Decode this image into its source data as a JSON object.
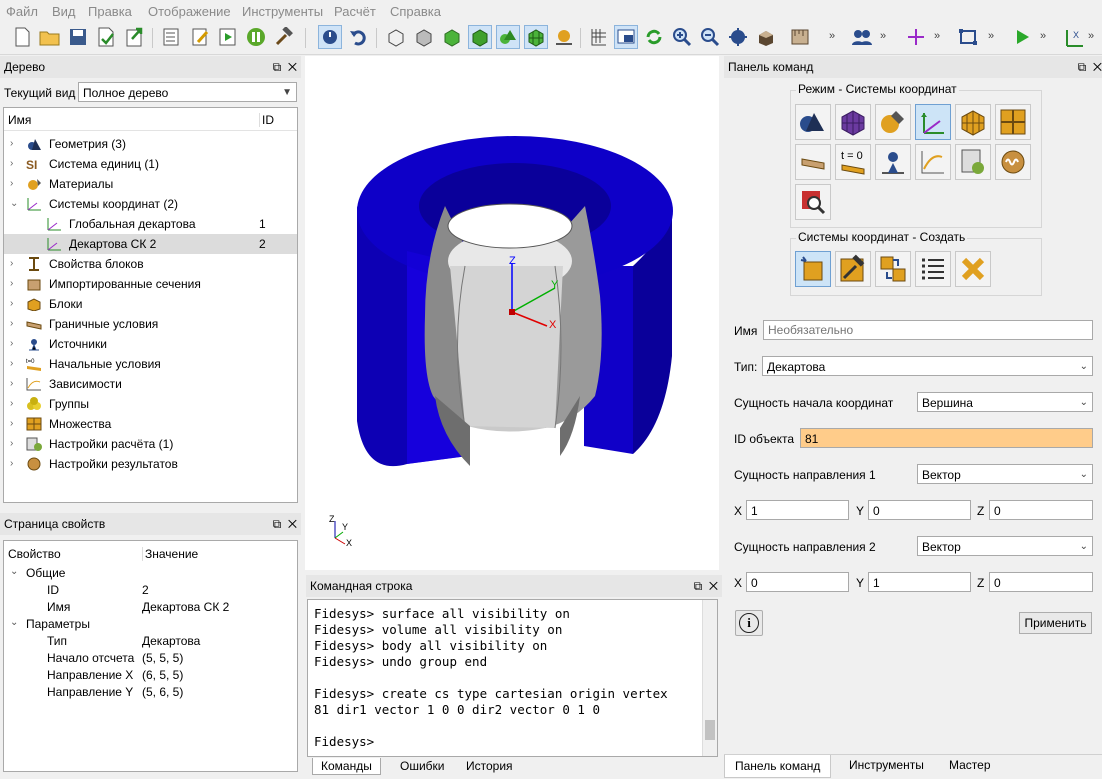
{
  "menu": [
    "Файл",
    "Вид",
    "Правка",
    "Отображение",
    "Инструменты",
    "Расчёт",
    "Справка"
  ],
  "tree_panel": {
    "title": "Дерево",
    "view_label": "Текущий вид",
    "view_value": "Полное дерево",
    "col_name": "Имя",
    "col_id": "ID",
    "items": [
      {
        "label": "Геометрия (3)",
        "id": "",
        "icon": "geometry-icon",
        "expanded": false
      },
      {
        "label": "Система единиц (1)",
        "id": "",
        "icon": "units-icon",
        "expanded": false
      },
      {
        "label": "Материалы",
        "id": "",
        "icon": "materials-icon",
        "expanded": null
      },
      {
        "label": "Системы координат (2)",
        "id": "",
        "icon": "coord-systems-icon",
        "expanded": true
      },
      {
        "label": "Глобальная декартова",
        "id": "1",
        "icon": "axes-icon",
        "child": true
      },
      {
        "label": "Декартова СК 2",
        "id": "2",
        "icon": "axes-icon",
        "child": true,
        "selected": true
      },
      {
        "label": "Свойства блоков",
        "id": "",
        "icon": "beam-icon",
        "expanded": false
      },
      {
        "label": "Импортированные сечения",
        "id": "",
        "icon": "sections-icon",
        "expanded": null
      },
      {
        "label": "Блоки",
        "id": "",
        "icon": "blocks-icon",
        "expanded": null
      },
      {
        "label": "Граничные условия",
        "id": "",
        "icon": "bc-icon",
        "expanded": false
      },
      {
        "label": "Источники",
        "id": "",
        "icon": "sources-icon",
        "expanded": false
      },
      {
        "label": "Начальные условия",
        "id": "",
        "icon": "initial-icon",
        "expanded": false
      },
      {
        "label": "Зависимости",
        "id": "",
        "icon": "dependencies-icon",
        "expanded": false
      },
      {
        "label": "Группы",
        "id": "",
        "icon": "groups-icon",
        "expanded": null
      },
      {
        "label": "Множества",
        "id": "",
        "icon": "sets-icon",
        "expanded": false
      },
      {
        "label": "Настройки расчёта (1)",
        "id": "",
        "icon": "calc-settings-icon",
        "expanded": false
      },
      {
        "label": "Настройки результатов",
        "id": "",
        "icon": "results-icon",
        "expanded": false
      }
    ]
  },
  "props_panel": {
    "title": "Страница свойств",
    "col_prop": "Свойство",
    "col_val": "Значение",
    "rows": [
      {
        "name": "Общие",
        "value": "",
        "group": true
      },
      {
        "name": "ID",
        "value": "2"
      },
      {
        "name": "Имя",
        "value": "Декартова СК 2"
      },
      {
        "name": "Параметры",
        "value": "",
        "group": true
      },
      {
        "name": "Тип",
        "value": "Декартова"
      },
      {
        "name": "Начало отсчета",
        "value": "(5, 5, 5)"
      },
      {
        "name": "Направление X",
        "value": "(6, 5, 5)"
      },
      {
        "name": "Направление Y",
        "value": "(5, 6, 5)"
      }
    ]
  },
  "viewport": {
    "axis_z": "Z",
    "axis_y": "Y",
    "axis_x": "X",
    "colors": {
      "outer": "#0a00c8",
      "inner": "#d8d8d8"
    }
  },
  "console": {
    "title": "Командная строка",
    "lines": [
      "Fidesys> surface all visibility on",
      "Fidesys> volume all visibility on",
      "Fidesys> body all visibility on",
      "Fidesys> undo group end",
      "",
      "Fidesys> create cs type cartesian origin vertex",
      "81 dir1 vector 1 0 0 dir2 vector 0 1 0",
      "",
      "Fidesys>"
    ],
    "tabs": [
      "Команды",
      "Ошибки",
      "История"
    ]
  },
  "command_panel": {
    "title": "Панель команд",
    "mode_group": "Режим - Системы координат",
    "create_group": "Системы координат - Создать",
    "name_label": "Имя",
    "name_placeholder": "Необязательно",
    "type_label": "Тип:",
    "type_value": "Декартова",
    "origin_label": "Сущность начала координат",
    "origin_value": "Вершина",
    "id_label": "ID объекта",
    "id_value": "81",
    "dir1_label": "Сущность направления 1",
    "dir1_value": "Вектор",
    "dir1": {
      "x_label": "X",
      "x": "1",
      "y_label": "Y",
      "y": "0",
      "z_label": "Z",
      "z": "0"
    },
    "dir2_label": "Сущность направления 2",
    "dir2_value": "Вектор",
    "dir2": {
      "x_label": "X",
      "x": "0",
      "y_label": "Y",
      "y": "1",
      "z_label": "Z",
      "z": "0"
    },
    "apply_label": "Применить",
    "info_label": "i",
    "tabs": [
      "Панель команд",
      "Инструменты",
      "Мастер"
    ],
    "t0_label": "t = 0"
  },
  "panel_buttons": {
    "float": "⧉",
    "close": "✕"
  },
  "toolbar_chevron": "»"
}
